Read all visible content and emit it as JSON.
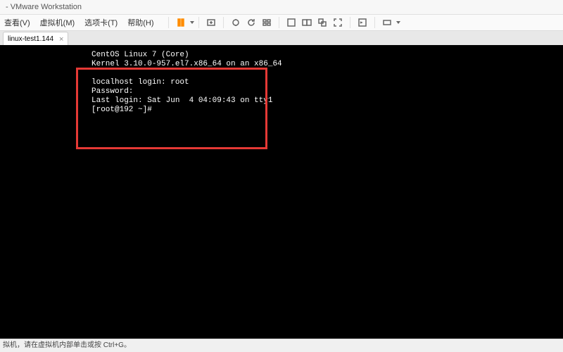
{
  "window": {
    "title": " - VMware Workstation"
  },
  "menu": {
    "view": "查看(V)",
    "vm": "虚拟机(M)",
    "tabs": "选项卡(T)",
    "help": "帮助(H)"
  },
  "tab": {
    "label": "linux-test1.144",
    "close": "×"
  },
  "terminal": {
    "line1": "CentOS Linux 7 (Core)",
    "line2": "Kernel 3.10.0-957.el7.x86_64 on an x86_64",
    "line3": "",
    "line4": "localhost login: root",
    "line5": "Password:",
    "line6": "Last login: Sat Jun  4 04:09:43 on tty1",
    "line7": "[root@192 ~]#"
  },
  "status": {
    "text": "拟机，请在虚拟机内部单击或按 Ctrl+G。"
  }
}
